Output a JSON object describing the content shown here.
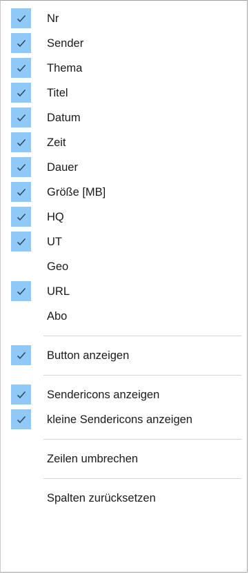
{
  "colors": {
    "check_background": "#90c8f6",
    "check_mark": "#2c4a66",
    "separator": "#d4d4d4",
    "text": "#1a1a1a"
  },
  "icons": {
    "check": "checkmark-icon"
  },
  "menu": {
    "columns": [
      {
        "label": "Nr",
        "checked": true
      },
      {
        "label": "Sender",
        "checked": true
      },
      {
        "label": "Thema",
        "checked": true
      },
      {
        "label": "Titel",
        "checked": true
      },
      {
        "label": "Datum",
        "checked": true
      },
      {
        "label": "Zeit",
        "checked": true
      },
      {
        "label": "Dauer",
        "checked": true
      },
      {
        "label": "Größe [MB]",
        "checked": true
      },
      {
        "label": "HQ",
        "checked": true
      },
      {
        "label": "UT",
        "checked": true
      },
      {
        "label": "Geo",
        "checked": false
      },
      {
        "label": "URL",
        "checked": true
      },
      {
        "label": "Abo",
        "checked": false
      }
    ],
    "button_anzeigen": {
      "label": "Button anzeigen",
      "checked": true
    },
    "sendericons": {
      "label": "Sendericons anzeigen",
      "checked": true
    },
    "kleine_sendericons": {
      "label": "kleine Sendericons anzeigen",
      "checked": true
    },
    "zeilen_umbrechen": {
      "label": "Zeilen umbrechen",
      "checked": false
    },
    "spalten_zuruecksetzen": {
      "label": "Spalten zurücksetzen"
    }
  }
}
